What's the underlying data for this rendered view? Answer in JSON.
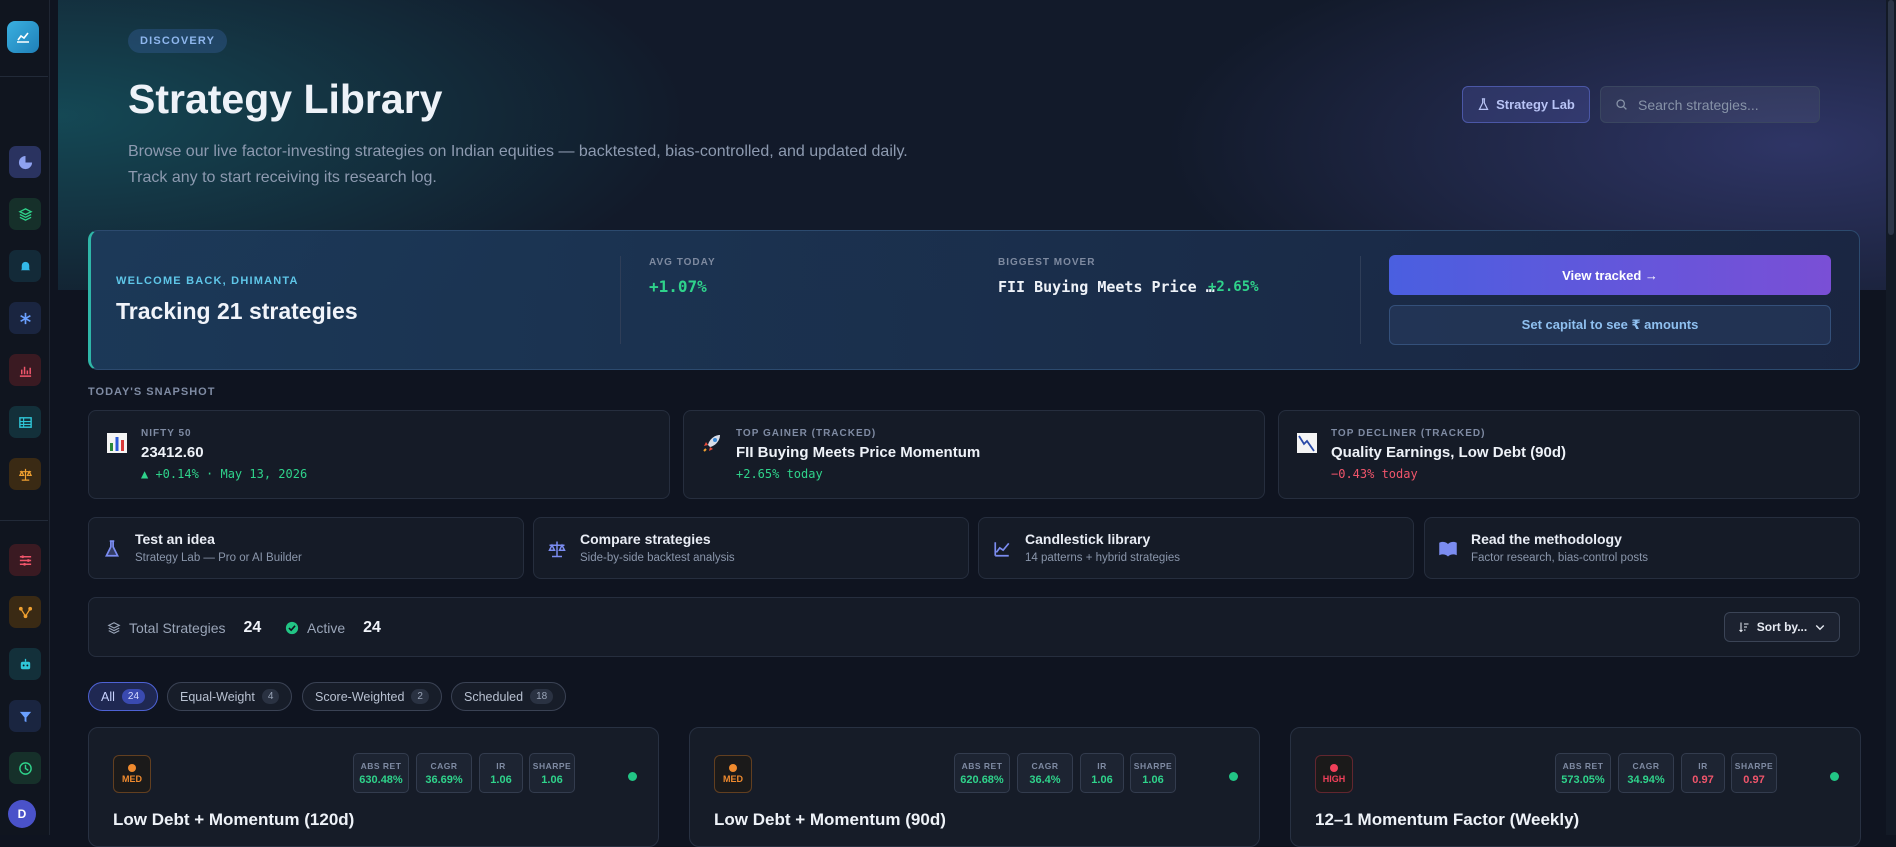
{
  "hero": {
    "badge": "DISCOVERY",
    "title": "Strategy Library",
    "subtitle_line1": "Browse our live factor-investing strategies on Indian equities — backtested, bias-controlled, and updated daily.",
    "subtitle_line2": "Track any to start receiving its research log.",
    "lab_button": "Strategy Lab",
    "search_placeholder": "Search strategies..."
  },
  "welcome": {
    "label": "WELCOME BACK, DHIMANTA",
    "title": "Tracking 21 strategies",
    "avg_label": "AVG TODAY",
    "avg_value": "+1.07%",
    "mover_label": "BIGGEST MOVER",
    "mover_name": "FII Buying Meets Price …",
    "mover_value": "+2.65%",
    "view_tracked": "View tracked →",
    "set_capital": "Set capital to see ₹ amounts"
  },
  "snapshot": {
    "label": "TODAY'S SNAPSHOT",
    "items": [
      {
        "label": "NIFTY 50",
        "main": "23412.60",
        "sub": "▲ +0.14% · May 13, 2026",
        "icon": "bar-chart-icon"
      },
      {
        "label": "TOP GAINER (TRACKED)",
        "main": "FII Buying Meets Price Momentum",
        "sub": "+2.65% today",
        "icon": "rocket-icon"
      },
      {
        "label": "TOP DECLINER (TRACKED)",
        "main": "Quality Earnings, Low Debt (90d)",
        "sub": "−0.43% today",
        "icon": "chart-down-icon"
      }
    ]
  },
  "quick_links": [
    {
      "title": "Test an idea",
      "subtitle": "Strategy Lab — Pro or AI Builder",
      "icon": "flask-icon"
    },
    {
      "title": "Compare strategies",
      "subtitle": "Side-by-side backtest analysis",
      "icon": "scale-icon"
    },
    {
      "title": "Candlestick library",
      "subtitle": "14 patterns + hybrid strategies",
      "icon": "line-chart-icon"
    },
    {
      "title": "Read the methodology",
      "subtitle": "Factor research, bias-control posts",
      "icon": "book-icon"
    }
  ],
  "totals": {
    "total_label": "Total Strategies",
    "total_value": "24",
    "active_label": "Active",
    "active_value": "24",
    "sort_label": "Sort by..."
  },
  "filters": [
    {
      "label": "All",
      "count": "24",
      "active": true
    },
    {
      "label": "Equal-Weight",
      "count": "4",
      "active": false
    },
    {
      "label": "Score-Weighted",
      "count": "2",
      "active": false
    },
    {
      "label": "Scheduled",
      "count": "18",
      "active": false
    }
  ],
  "cards": [
    {
      "risk": "MED",
      "risk_color": "#f08a2e",
      "title": "Low Debt + Momentum (120d)",
      "metrics": [
        {
          "label": "ABS RET",
          "value": "630.48%"
        },
        {
          "label": "CAGR",
          "value": "36.69%"
        },
        {
          "label": "IR",
          "value": "1.06"
        },
        {
          "label": "SHARPE",
          "value": "1.06"
        }
      ],
      "metric_color": "#2fd38b"
    },
    {
      "risk": "MED",
      "risk_color": "#f08a2e",
      "title": "Low Debt + Momentum (90d)",
      "metrics": [
        {
          "label": "ABS RET",
          "value": "620.68%"
        },
        {
          "label": "CAGR",
          "value": "36.4%"
        },
        {
          "label": "IR",
          "value": "1.06"
        },
        {
          "label": "SHARPE",
          "value": "1.06"
        }
      ],
      "metric_color": "#2fd38b"
    },
    {
      "risk": "HIGH",
      "risk_color": "#f0405a",
      "title": "12–1 Momentum Factor (Weekly)",
      "metrics": [
        {
          "label": "ABS RET",
          "value": "573.05%"
        },
        {
          "label": "CAGR",
          "value": "34.94%"
        },
        {
          "label": "IR",
          "value": "0.97"
        },
        {
          "label": "SHARPE",
          "value": "0.97"
        }
      ],
      "metric_color": "#2fd38b",
      "ratio_color": "#f0556b"
    }
  ],
  "user": {
    "initial": "D"
  }
}
